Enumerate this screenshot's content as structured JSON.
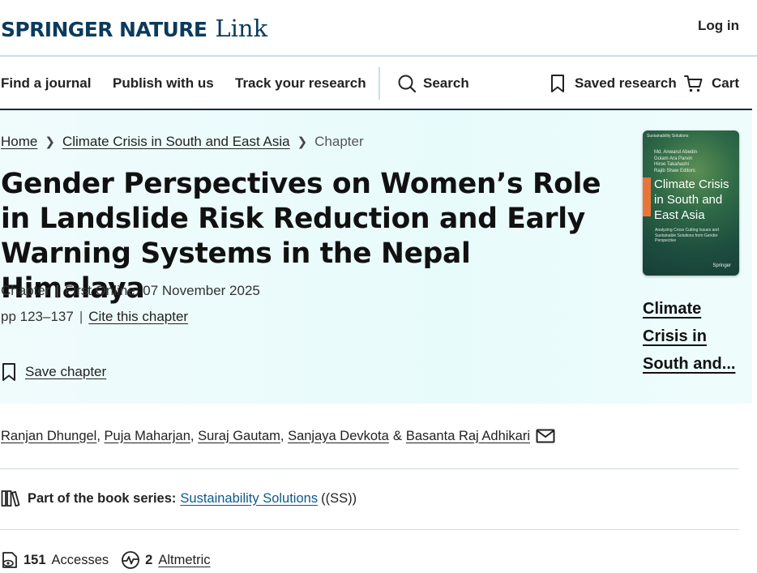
{
  "header": {
    "logo_brand": "SPRINGER NATURE",
    "logo_link": "Link",
    "login": "Log in"
  },
  "nav": {
    "find_journal": "Find a journal",
    "publish": "Publish with us",
    "track": "Track your research",
    "search": "Search",
    "saved": "Saved research",
    "cart": "Cart"
  },
  "breadcrumb": {
    "home": "Home",
    "book": "Climate Crisis in South and East Asia",
    "current": "Chapter"
  },
  "chapter": {
    "title": "Gender Perspectives on Women’s Role in Landslide Risk Reduction and Early Warning Systems in the Nepal Himalaya",
    "type": "Chapter",
    "first_online": "First Online: 07 November 2025",
    "pages": "pp 123–137",
    "cite": "Cite this chapter",
    "save": "Save chapter"
  },
  "book": {
    "link_text": "Climate Crisis in South and...",
    "cover_series": "Sustainability Solutions",
    "cover_authors": [
      "Md. Anwarul Abedin",
      "Golam Ara Parvin",
      "Hiroe Takahashi",
      "Rajib Shaw  Editors"
    ],
    "cover_title": "Climate Crisis in South and East Asia",
    "cover_subtitle": "Analyzing Cross Cutting Issues and Sustainable Solutions from Gender Perspective",
    "cover_publisher": "Springer"
  },
  "authors": {
    "list": [
      "Ranjan Dhungel",
      "Puja Maharjan",
      "Suraj Gautam",
      "Sanjaya Devkota",
      "Basanta Raj Adhikari"
    ],
    "amp": "&"
  },
  "series": {
    "label": "Part of the book series:",
    "name": "Sustainability Solutions",
    "abbr": "((SS))"
  },
  "stats": {
    "accesses_count": "151",
    "accesses_label": "Accesses",
    "altmetric_count": "2",
    "altmetric_label": "Altmetric"
  },
  "icons": {
    "search": "search-icon",
    "bookmark": "bookmark-icon",
    "cart": "cart-icon",
    "mail": "mail-icon",
    "books": "books-icon",
    "accesses": "eye-icon",
    "altmetric": "altmetric-icon"
  }
}
